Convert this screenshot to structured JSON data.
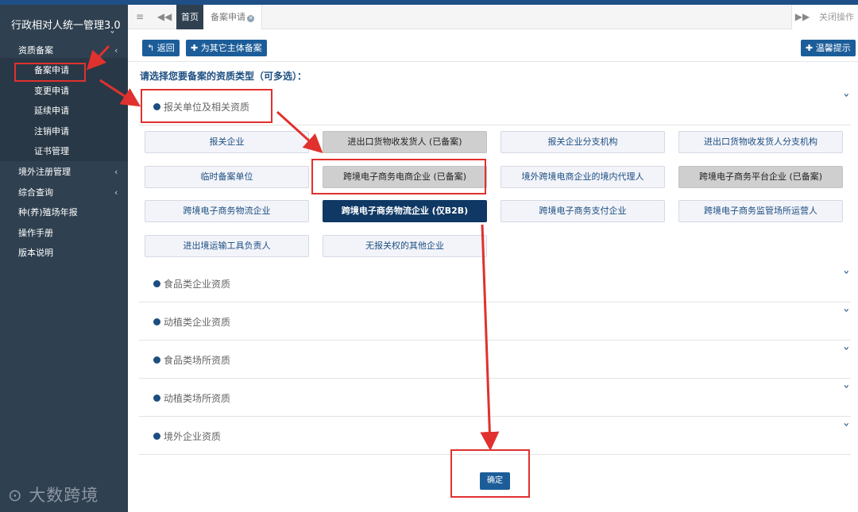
{
  "app": {
    "title": "行政相对人统一管理3.0"
  },
  "sidebar": {
    "menu_top": {
      "label": "资质备案"
    },
    "submenu": [
      {
        "label": "备案申请"
      },
      {
        "label": "变更申请"
      },
      {
        "label": "延续申请"
      },
      {
        "label": "注销申请"
      },
      {
        "label": "证书管理"
      }
    ],
    "menu_rest": [
      {
        "label": "境外注册管理",
        "has_children": true
      },
      {
        "label": "综合查询",
        "has_children": true
      },
      {
        "label": "种(养)殖场年报",
        "has_children": false
      },
      {
        "label": "操作手册",
        "has_children": false
      },
      {
        "label": "版本说明",
        "has_children": false
      }
    ],
    "watermark": "大数跨境"
  },
  "tabbar": {
    "tabs": [
      {
        "label": "首页"
      },
      {
        "label": "备案申请"
      }
    ],
    "close_ops": "关闭操作"
  },
  "toolbar": {
    "back": "返回",
    "register_other": "为其它主体备案",
    "tips": "温馨提示"
  },
  "prompt": "请选择您要备案的资质类型（可多选）：",
  "sections": [
    {
      "title": "报关单位及相关资质",
      "expanded": true
    },
    {
      "title": "食品类企业资质",
      "expanded": false
    },
    {
      "title": "动植类企业资质",
      "expanded": false
    },
    {
      "title": "食品类场所资质",
      "expanded": false
    },
    {
      "title": "动植类场所资质",
      "expanded": false
    },
    {
      "title": "境外企业资质",
      "expanded": false
    }
  ],
  "qualifications": [
    {
      "label": "报关企业",
      "state": "normal"
    },
    {
      "label": "进出口货物收发货人 (已备案)",
      "state": "registered"
    },
    {
      "label": "报关企业分支机构",
      "state": "normal"
    },
    {
      "label": "进出口货物收发货人分支机构",
      "state": "normal"
    },
    {
      "label": "临时备案单位",
      "state": "normal"
    },
    {
      "label": "跨境电子商务电商企业 (已备案)",
      "state": "registered"
    },
    {
      "label": "境外跨境电商企业的境内代理人",
      "state": "normal"
    },
    {
      "label": "跨境电子商务平台企业 (已备案)",
      "state": "registered"
    },
    {
      "label": "跨境电子商务物流企业",
      "state": "normal"
    },
    {
      "label": "跨境电子商务物流企业 (仅B2B)",
      "state": "selected"
    },
    {
      "label": "跨境电子商务支付企业",
      "state": "normal"
    },
    {
      "label": "跨境电子商务监管场所运营人",
      "state": "normal"
    },
    {
      "label": "进出境运输工具负责人",
      "state": "normal"
    },
    {
      "label": "无报关权的其他企业",
      "state": "normal"
    }
  ],
  "confirm": "确定",
  "colors": {
    "sidebar_bg": "#2f4050",
    "primary": "#1c5d99",
    "selected": "#0f3864",
    "annotation": "#e0312e"
  },
  "icons": [
    "menu-icon",
    "prev-tab-icon",
    "next-tab-icon",
    "back-arrow-icon",
    "plus-icon",
    "chevron-down-icon",
    "chevron-left-icon",
    "close-icon"
  ]
}
